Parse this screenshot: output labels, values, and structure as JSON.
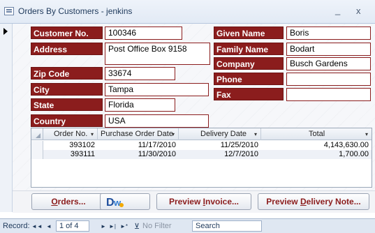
{
  "window": {
    "title": "Orders By Customers - jenkins",
    "minimize": "_",
    "close": "x"
  },
  "labels": {
    "customer_no": "Customer No.",
    "address": "Address",
    "zip_code": "Zip Code",
    "city": "City",
    "state": "State",
    "country": "Country",
    "given_name": "Given Name",
    "family_name": "Family Name",
    "company": "Company",
    "phone": "Phone",
    "fax": "Fax"
  },
  "values": {
    "customer_no": "100346",
    "address": "Post Office Box 9158",
    "zip_code": "33674",
    "city": "Tampa",
    "state": "Florida",
    "country": "USA",
    "given_name": "Boris",
    "family_name": "Bodart",
    "company": "Busch Gardens",
    "phone": "",
    "fax": ""
  },
  "orders": {
    "columns": [
      "Order No.",
      "Purchase Order Date",
      "Delivery Date",
      "Total"
    ],
    "rows": [
      {
        "order_no": "393102",
        "po_date": "11/17/2010",
        "delivery": "11/25/2010",
        "total": "4,143,630.00"
      },
      {
        "order_no": "393111",
        "po_date": "11/30/2010",
        "delivery": "12/7/2010",
        "total": "1,700.00"
      }
    ]
  },
  "buttons": {
    "orders_pre": "",
    "orders_ul": "O",
    "orders_post": "rders...",
    "invoice_pre": "Preview ",
    "invoice_ul": "I",
    "invoice_post": "nvoice...",
    "delivery_pre": "Preview ",
    "delivery_ul": "D",
    "delivery_post": "elivery Note..."
  },
  "status": {
    "record_label": "Record:",
    "first": "◄◄",
    "prev": "◄",
    "position": "1 of 4",
    "next": "►",
    "last": "►|",
    "new": "►*",
    "filter": "No Filter",
    "search": "Search"
  },
  "colors": {
    "label_bg": "#8b1d1d",
    "field_border": "#8b1d1d",
    "title_text": "#1e395b"
  }
}
